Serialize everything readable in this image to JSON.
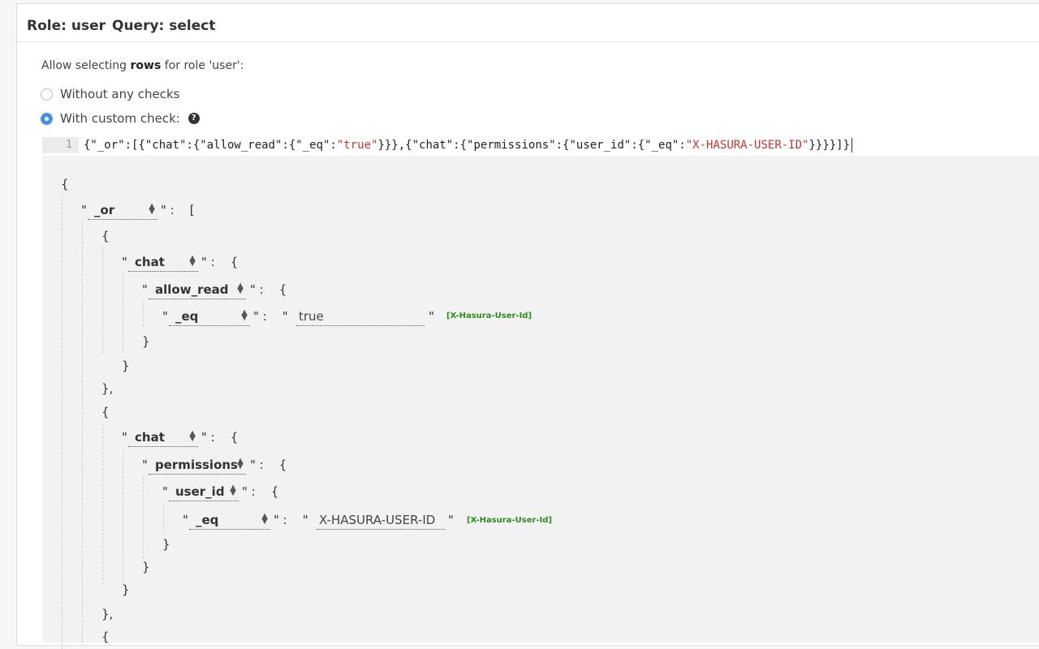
{
  "header": {
    "role": "Role: user",
    "query": "Query: select"
  },
  "allow_text": {
    "prefix": "Allow selecting ",
    "bold": "rows",
    "suffix": " for role 'user':"
  },
  "radios": [
    {
      "label": "Without any checks",
      "checked": false
    },
    {
      "label": "With custom check:",
      "checked": true
    }
  ],
  "editor": {
    "line_number": "1",
    "json_part1": "{\"_or\":[{\"chat\":{\"allow_read\":{\"_eq\":",
    "json_str1": "\"true\"",
    "json_part2": "}}},{\"chat\":{\"permissions\":{\"user_id\":{\"_eq\":",
    "json_str2": "\"X-HASURA-USER-ID\"",
    "json_part3": "}}}}]}"
  },
  "builder": {
    "keys": {
      "or": "_or",
      "chat1": "chat",
      "allow_read": "allow_read",
      "eq1": "_eq",
      "chat2": "chat",
      "permissions": "permissions",
      "user_id": "user_id",
      "eq2": "_eq"
    },
    "values": {
      "v1": "true",
      "v2": "X-HASURA-USER-ID"
    },
    "hint": "[X-Hasura-User-Id]",
    "colors": {
      "hint": "#2e8b1e",
      "string": "#cc3333",
      "radio_checked": "#4a90e2"
    }
  }
}
